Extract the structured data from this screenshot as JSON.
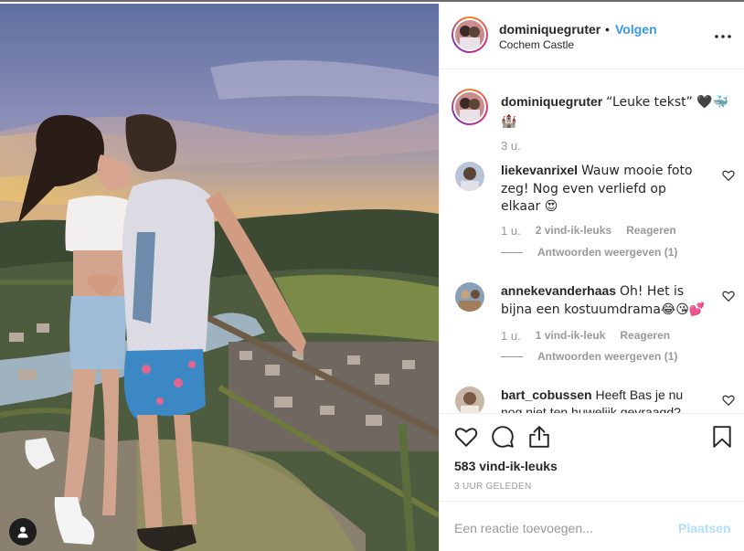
{
  "post": {
    "username": "dominiquegruter",
    "follow_separator": "•",
    "follow_label": "Volgen",
    "location": "Cochem Castle",
    "more_icon": "more-horizontal-icon"
  },
  "caption": {
    "username": "dominiquegruter",
    "text": "“Leuke tekst” 🖤🐳🏰",
    "time": "3 u."
  },
  "comments": [
    {
      "username": "liekevanrixel",
      "text": "Wauw mooie foto zeg! Nog even verliefd op elkaar 😍",
      "time": "1 u.",
      "likes": "2 vind-ik-leuks",
      "reply_label": "Reageren",
      "view_replies": "Antwoorden weergeven (1)"
    },
    {
      "username": "annekevanderhaas",
      "text": "Oh! Het is bijna een kostuumdrama😂😘💕",
      "time": "1 u.",
      "likes": "1 vind-ik-leuk",
      "reply_label": "Reageren",
      "view_replies": "Antwoorden weergeven (1)"
    },
    {
      "username": "bart_cobussen",
      "text": "Heeft Bas je nu nog niet ten huwelijk gevraagd?"
    }
  ],
  "actions": {
    "like_icon": "heart-icon",
    "comment_icon": "comment-icon",
    "share_icon": "share-icon",
    "save_icon": "bookmark-icon"
  },
  "likes": "583 vind-ik-leuks",
  "posted_time": "3 UUR GELEDEN",
  "add_comment": {
    "placeholder": "Een reactie toevoegen...",
    "post_label": "Plaatsen"
  },
  "colors": {
    "link": "#3897f0",
    "post_disabled": "#b2dffc",
    "muted": "#999999",
    "text": "#262626"
  }
}
